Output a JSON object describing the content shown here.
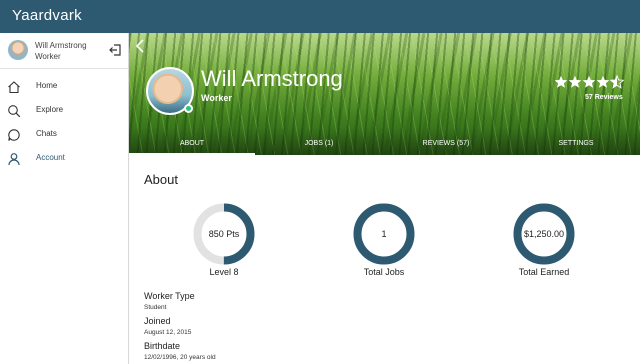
{
  "app": {
    "title": "Yaardvark"
  },
  "sidebar": {
    "user": {
      "name": "Will Armstrong",
      "role": "Worker"
    },
    "items": [
      {
        "label": "Home",
        "icon": "home-icon"
      },
      {
        "label": "Explore",
        "icon": "search-icon"
      },
      {
        "label": "Chats",
        "icon": "chat-icon"
      },
      {
        "label": "Account",
        "icon": "person-icon",
        "active": true
      }
    ]
  },
  "profile": {
    "name": "Will Armstrong",
    "role": "Worker",
    "rating": 4.5,
    "reviews_label": "57 Reviews",
    "online_color": "#2ec27e"
  },
  "tabs": [
    {
      "label": "ABOUT",
      "active": true
    },
    {
      "label": "JOBS (1)"
    },
    {
      "label": "REVIEWS (57)"
    },
    {
      "label": "SETTINGS"
    }
  ],
  "about": {
    "title": "About",
    "stats": [
      {
        "value": "850 Pts",
        "label": "Level 8",
        "progress": 0.5
      },
      {
        "value": "1",
        "label": "Total Jobs",
        "progress": 1.0
      },
      {
        "value": "$1,250.00",
        "label": "Total Earned",
        "progress": 1.0
      }
    ],
    "fields": [
      {
        "label": "Worker Type",
        "value": "Student"
      },
      {
        "label": "Joined",
        "value": "August 12, 2015"
      },
      {
        "label": "Birthdate",
        "value": "12/02/1996, 20 years old"
      }
    ]
  },
  "colors": {
    "brand": "#2e5a71",
    "ring_track": "#e2e2e2"
  }
}
